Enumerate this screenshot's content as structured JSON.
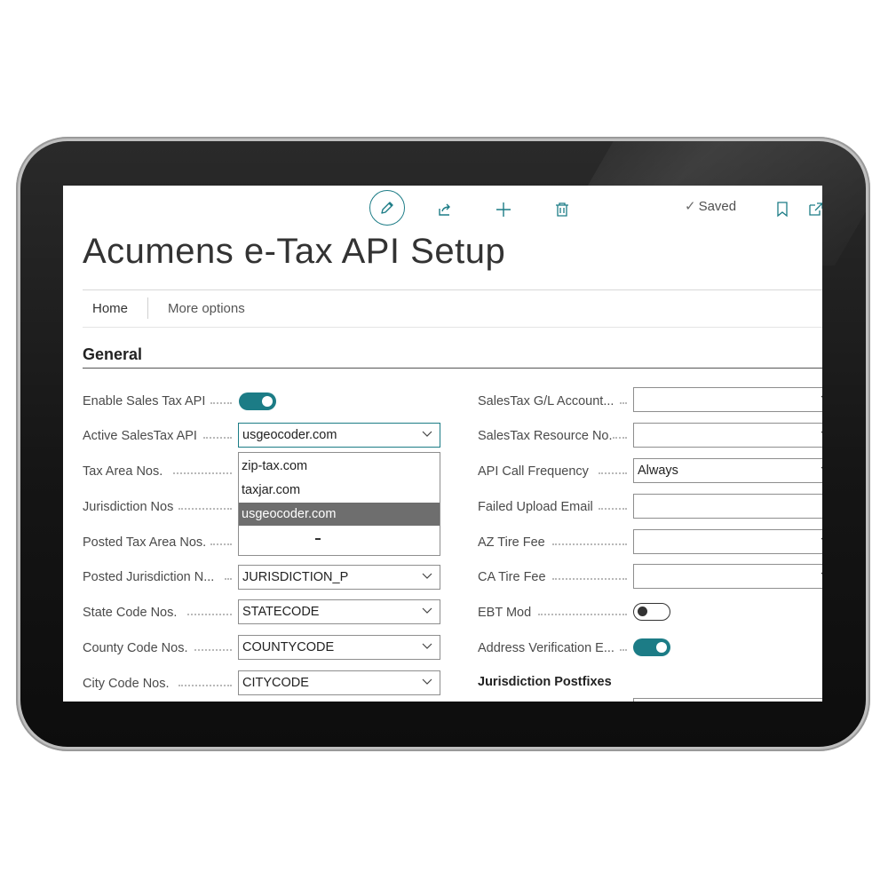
{
  "toolbar": {
    "edit_icon": "pencil-icon",
    "share_icon": "share-icon",
    "new_icon": "plus-icon",
    "delete_icon": "trash-icon",
    "saved_label": "Saved",
    "bookmark_icon": "bookmark-icon",
    "open_icon": "open-in-new-icon"
  },
  "page": {
    "title": "Acumens e-Tax API Setup"
  },
  "nav": {
    "home": "Home",
    "more": "More options"
  },
  "section": {
    "title": "General"
  },
  "left_fields": [
    {
      "label": "Enable Sales Tax API",
      "type": "toggle",
      "state": "on"
    },
    {
      "label": "Active SalesTax API",
      "type": "select",
      "value": "usgeocoder.com"
    },
    {
      "label": "Tax Area Nos.",
      "type": "select",
      "value": ""
    },
    {
      "label": "Jurisdiction Nos",
      "type": "select",
      "value": ""
    },
    {
      "label": "Posted Tax Area Nos.",
      "type": "select",
      "value": ""
    },
    {
      "label": "Posted Jurisdiction N...",
      "type": "select",
      "value": "JURISDICTION_P"
    },
    {
      "label": "State Code Nos.",
      "type": "select",
      "value": "STATECODE"
    },
    {
      "label": "County Code Nos.",
      "type": "select",
      "value": "COUNTYCODE"
    },
    {
      "label": "City Code Nos.",
      "type": "select",
      "value": "CITYCODE"
    }
  ],
  "dropdown": {
    "options": [
      "zip-tax.com",
      "taxjar.com",
      "usgeocoder.com"
    ],
    "selected": "usgeocoder.com"
  },
  "right_fields": [
    {
      "label": "SalesTax G/L Account...",
      "type": "select",
      "value": ""
    },
    {
      "label": "SalesTax Resource No.",
      "type": "select",
      "value": ""
    },
    {
      "label": "API Call Frequency",
      "type": "select",
      "value": "Always"
    },
    {
      "label": "Failed Upload Email",
      "type": "text",
      "value": ""
    },
    {
      "label": "AZ Tire Fee",
      "type": "select",
      "value": ""
    },
    {
      "label": "CA Tire Fee",
      "type": "select",
      "value": ""
    },
    {
      "label": "EBT Mod",
      "type": "toggle",
      "state": "off"
    },
    {
      "label": "Address Verification E...",
      "type": "toggle",
      "state": "on"
    }
  ],
  "subsection": {
    "title": "Jurisdiction Postfixes"
  },
  "colors": {
    "accent": "#1c7c86",
    "selected_option": "#6e6e6e"
  }
}
